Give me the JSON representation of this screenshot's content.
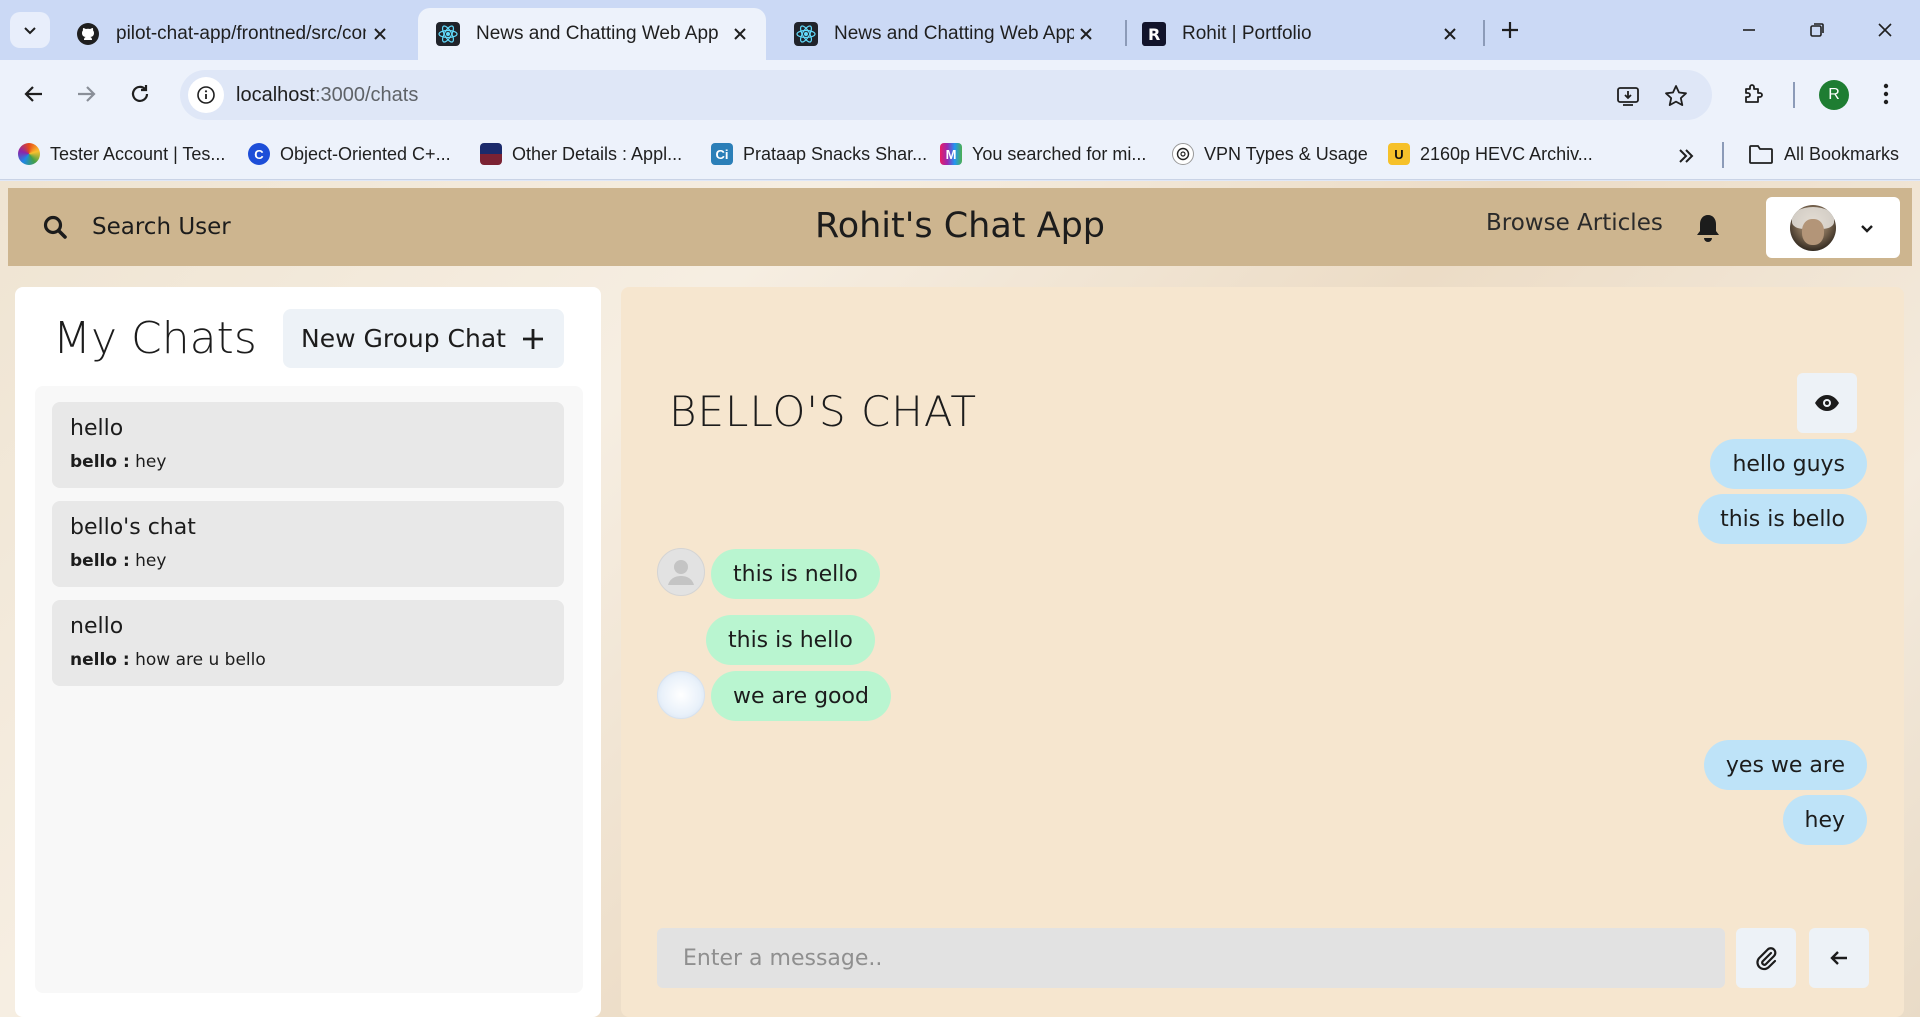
{
  "browser": {
    "tabs": [
      {
        "title": "pilot-chat-app/frontned/src/com",
        "icon": "github-icon",
        "active": false
      },
      {
        "title": "News and Chatting Web App",
        "icon": "react-icon",
        "active": true
      },
      {
        "title": "News and Chatting Web App",
        "icon": "react-icon",
        "active": false
      },
      {
        "title": "Rohit | Portfolio",
        "icon": "portfolio-r-icon",
        "active": false
      }
    ],
    "address": {
      "host": "localhost",
      "path": ":3000/chats"
    },
    "profile_initial": "R",
    "bookmarks": [
      {
        "label": "Tester Account | Tes...",
        "icon": "multicolor-circle-icon"
      },
      {
        "label": "Object-Oriented C+...",
        "icon": "c-logo-icon",
        "color": "#1d4ed8"
      },
      {
        "label": "Other Details : Appl...",
        "icon": "app-tile-icon",
        "color": "#7b2233"
      },
      {
        "label": "Prataap Snacks Shar...",
        "icon": "ci-icon",
        "color": "#2b7fb8"
      },
      {
        "label": "You searched for mi...",
        "icon": "m-logo-icon"
      },
      {
        "label": "VPN Types & Usage",
        "icon": "openai-icon"
      },
      {
        "label": "2160p HEVC Archiv...",
        "icon": "uhd-icon",
        "color": "#f6c12a"
      }
    ],
    "all_bookmarks_label": "All Bookmarks"
  },
  "header": {
    "search_label": "Search User",
    "app_title": "Rohit's Chat App",
    "browse_label": "Browse Articles"
  },
  "sidebar": {
    "heading": "My Chats",
    "new_group_label": "New Group Chat",
    "chats": [
      {
        "name": "hello",
        "sender": "bello :",
        "message": "hey"
      },
      {
        "name": "bello's chat",
        "sender": "bello :",
        "message": "hey"
      },
      {
        "name": "nello",
        "sender": "nello :",
        "message": "how are u bello"
      }
    ]
  },
  "chat": {
    "title": "BELLO'S CHAT",
    "messages": [
      {
        "text": "hello guys",
        "mine": true
      },
      {
        "text": "this is bello",
        "mine": true
      },
      {
        "text": "this is nello",
        "mine": false
      },
      {
        "text": "this is hello",
        "mine": false
      },
      {
        "text": "we are good",
        "mine": false
      },
      {
        "text": "yes we are",
        "mine": true
      },
      {
        "text": "hey",
        "mine": true
      }
    ],
    "input_placeholder": "Enter a message.."
  },
  "colors": {
    "header_bg": "#cdb58f",
    "chat_panel_bg": "#f6e6cf",
    "my_bubble": "#bee3f8",
    "their_bubble": "#b9f5d0"
  }
}
